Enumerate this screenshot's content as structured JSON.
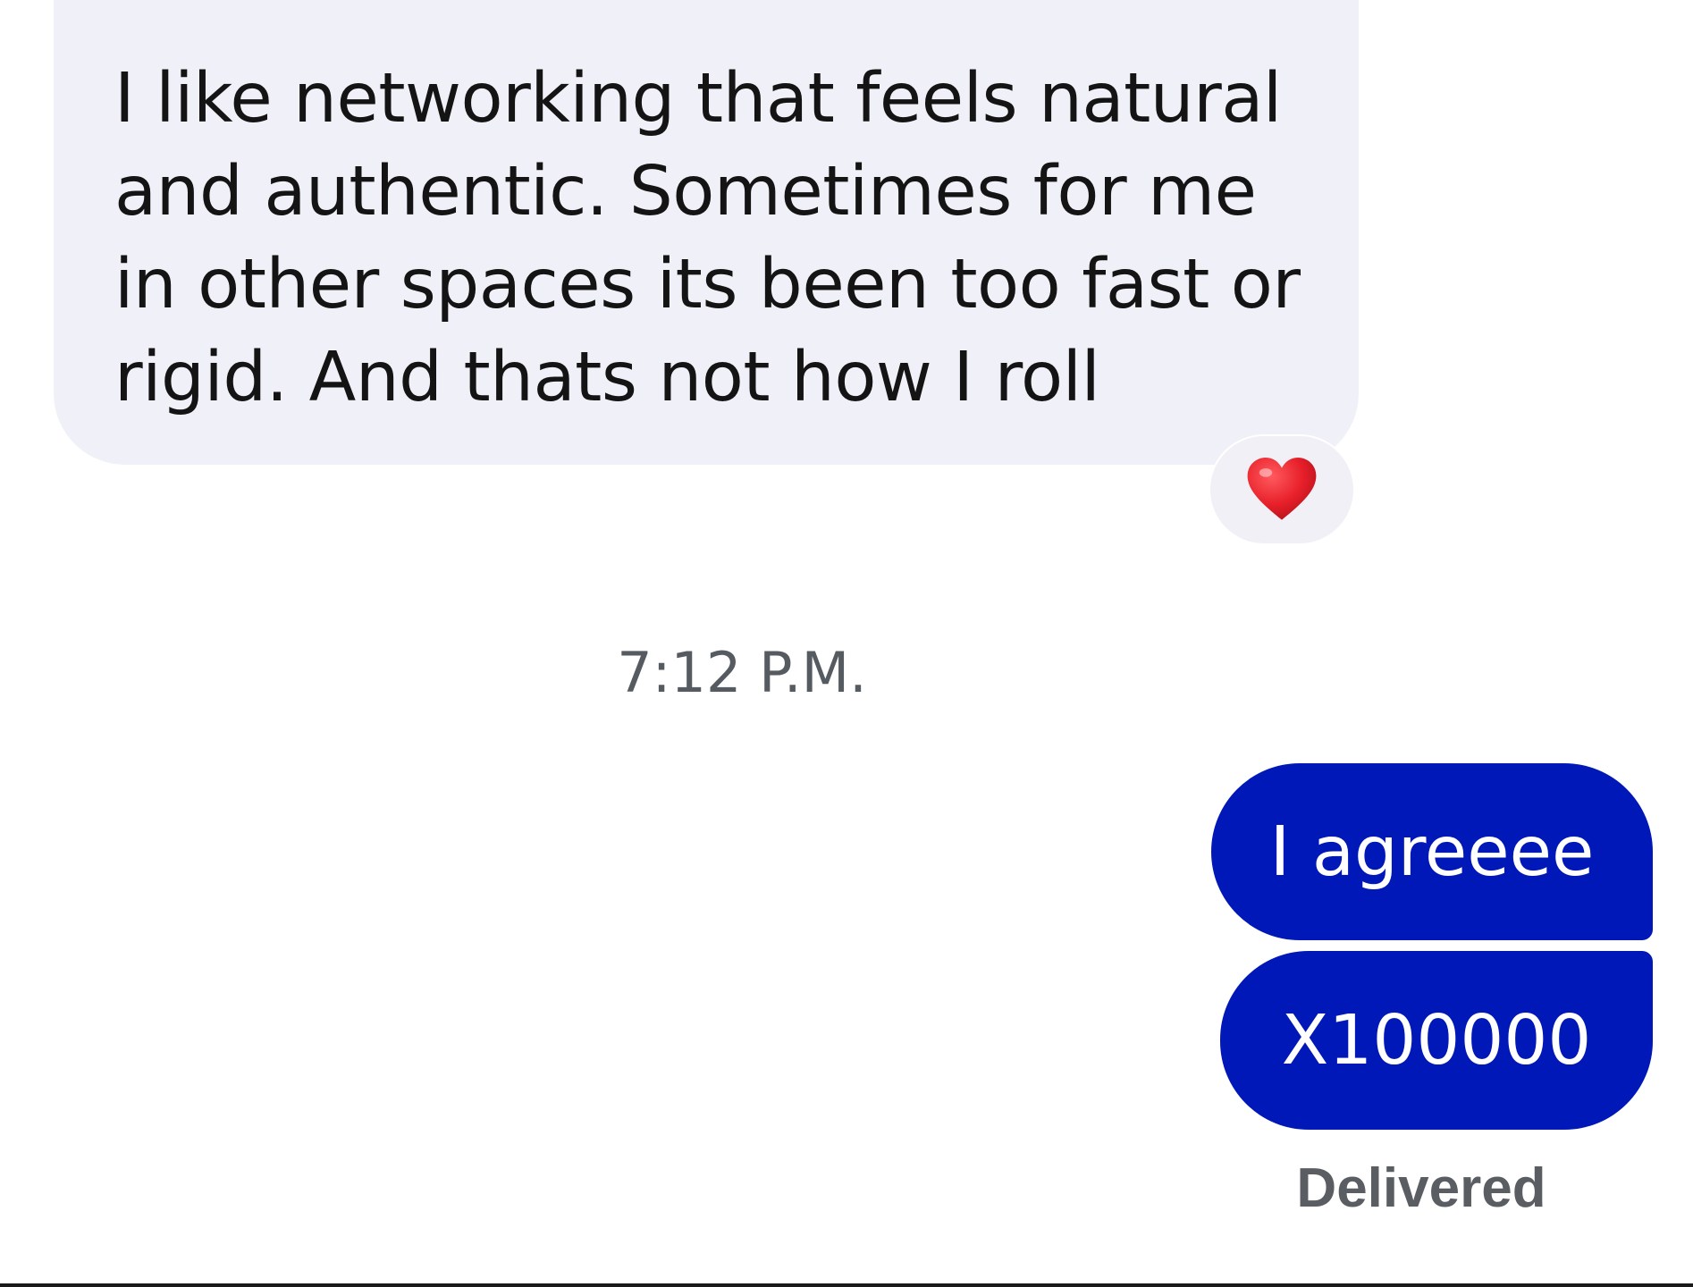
{
  "thread": {
    "messages": [
      {
        "direction": "incoming",
        "text": "I like networking that feels natural and authentic. Sometimes for me in other spaces its been too fast or rigid. And thats not how I roll",
        "reaction": "heart-icon"
      }
    ],
    "timestamp": "7:12 P.M.",
    "outgoing": [
      {
        "text": "I agreeee"
      },
      {
        "text": "X100000"
      }
    ],
    "status": "Delivered"
  },
  "colors": {
    "incoming_bubble": "#f0f0f8",
    "outgoing_bubble": "#0018b8",
    "reaction_heart": "#e8202a",
    "timestamp_text": "#555b61",
    "status_text": "#5a5e63"
  }
}
